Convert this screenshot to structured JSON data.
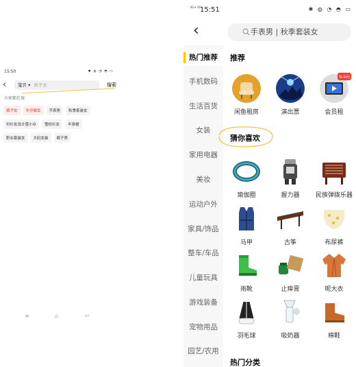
{
  "left": {
    "status_time": "15:50",
    "status_icons": "✱ ◍ ◔ ◓ ▭",
    "back_icon": "‹",
    "scope_label": "宝贝 ▾",
    "search_placeholder": "裤子女",
    "search_button": "搜索",
    "hot_label": "大家都在搜",
    "tag_rows": [
      [
        {
          "text": "裤子女",
          "hot": true
        },
        {
          "text": "牛仔裤女",
          "hot": true
        },
        {
          "text": "手表男",
          "hot": false
        },
        {
          "text": "秋季套装女",
          "hot": false
        }
      ],
      [
        {
          "text": "衬衫女设计感小众",
          "hot": false
        },
        {
          "text": "雪纺衫女",
          "hot": false
        },
        {
          "text": "半身裙",
          "hot": false
        }
      ],
      [
        {
          "text": "职业套装女",
          "hot": false
        },
        {
          "text": "大码女装",
          "hot": false
        },
        {
          "text": "裤子男",
          "hot": false
        }
      ]
    ],
    "nav": {
      "menu": "≡",
      "home": "⌂",
      "back": "↩"
    }
  },
  "right": {
    "status_mini": "4G+ 4G",
    "status_time": "15:51",
    "status_icons": "✱ ◍ ◔ ◓ ▭",
    "back_icon": "‹",
    "search_icon": "search-icon",
    "search_placeholder": "手表男 | 秋季套装女",
    "categories": [
      {
        "label": "热门推荐"
      },
      {
        "label": "手机数码"
      },
      {
        "label": "生活百货"
      },
      {
        "label": "女装"
      },
      {
        "label": "家用电器"
      },
      {
        "label": "美妆"
      },
      {
        "label": "运动户外"
      },
      {
        "label": "家具/饰品"
      },
      {
        "label": "整车/车品"
      },
      {
        "label": "儿童玩具"
      },
      {
        "label": "游戏装备"
      },
      {
        "label": "宠物用品"
      },
      {
        "label": "园艺/农用"
      }
    ],
    "recommend_title": "推荐",
    "recommend_items": [
      {
        "label": "闲鱼租房"
      },
      {
        "label": "演出票"
      },
      {
        "label": "会员租",
        "badge": "9.9元"
      }
    ],
    "guess_title": "猜你喜欢",
    "guess_items": [
      {
        "label": "瑜伽圈"
      },
      {
        "label": "握力器"
      },
      {
        "label": "民族弹拨乐器"
      },
      {
        "label": "马甲"
      },
      {
        "label": "古筝"
      },
      {
        "label": "布尿裤"
      },
      {
        "label": "雨靴"
      },
      {
        "label": "止痒膏"
      },
      {
        "label": "呢大衣"
      },
      {
        "label": "羽毛球"
      },
      {
        "label": "吸奶器"
      },
      {
        "label": "棉鞋"
      }
    ],
    "hot_category_title": "热门分类",
    "accent_color": "#ffc300"
  }
}
